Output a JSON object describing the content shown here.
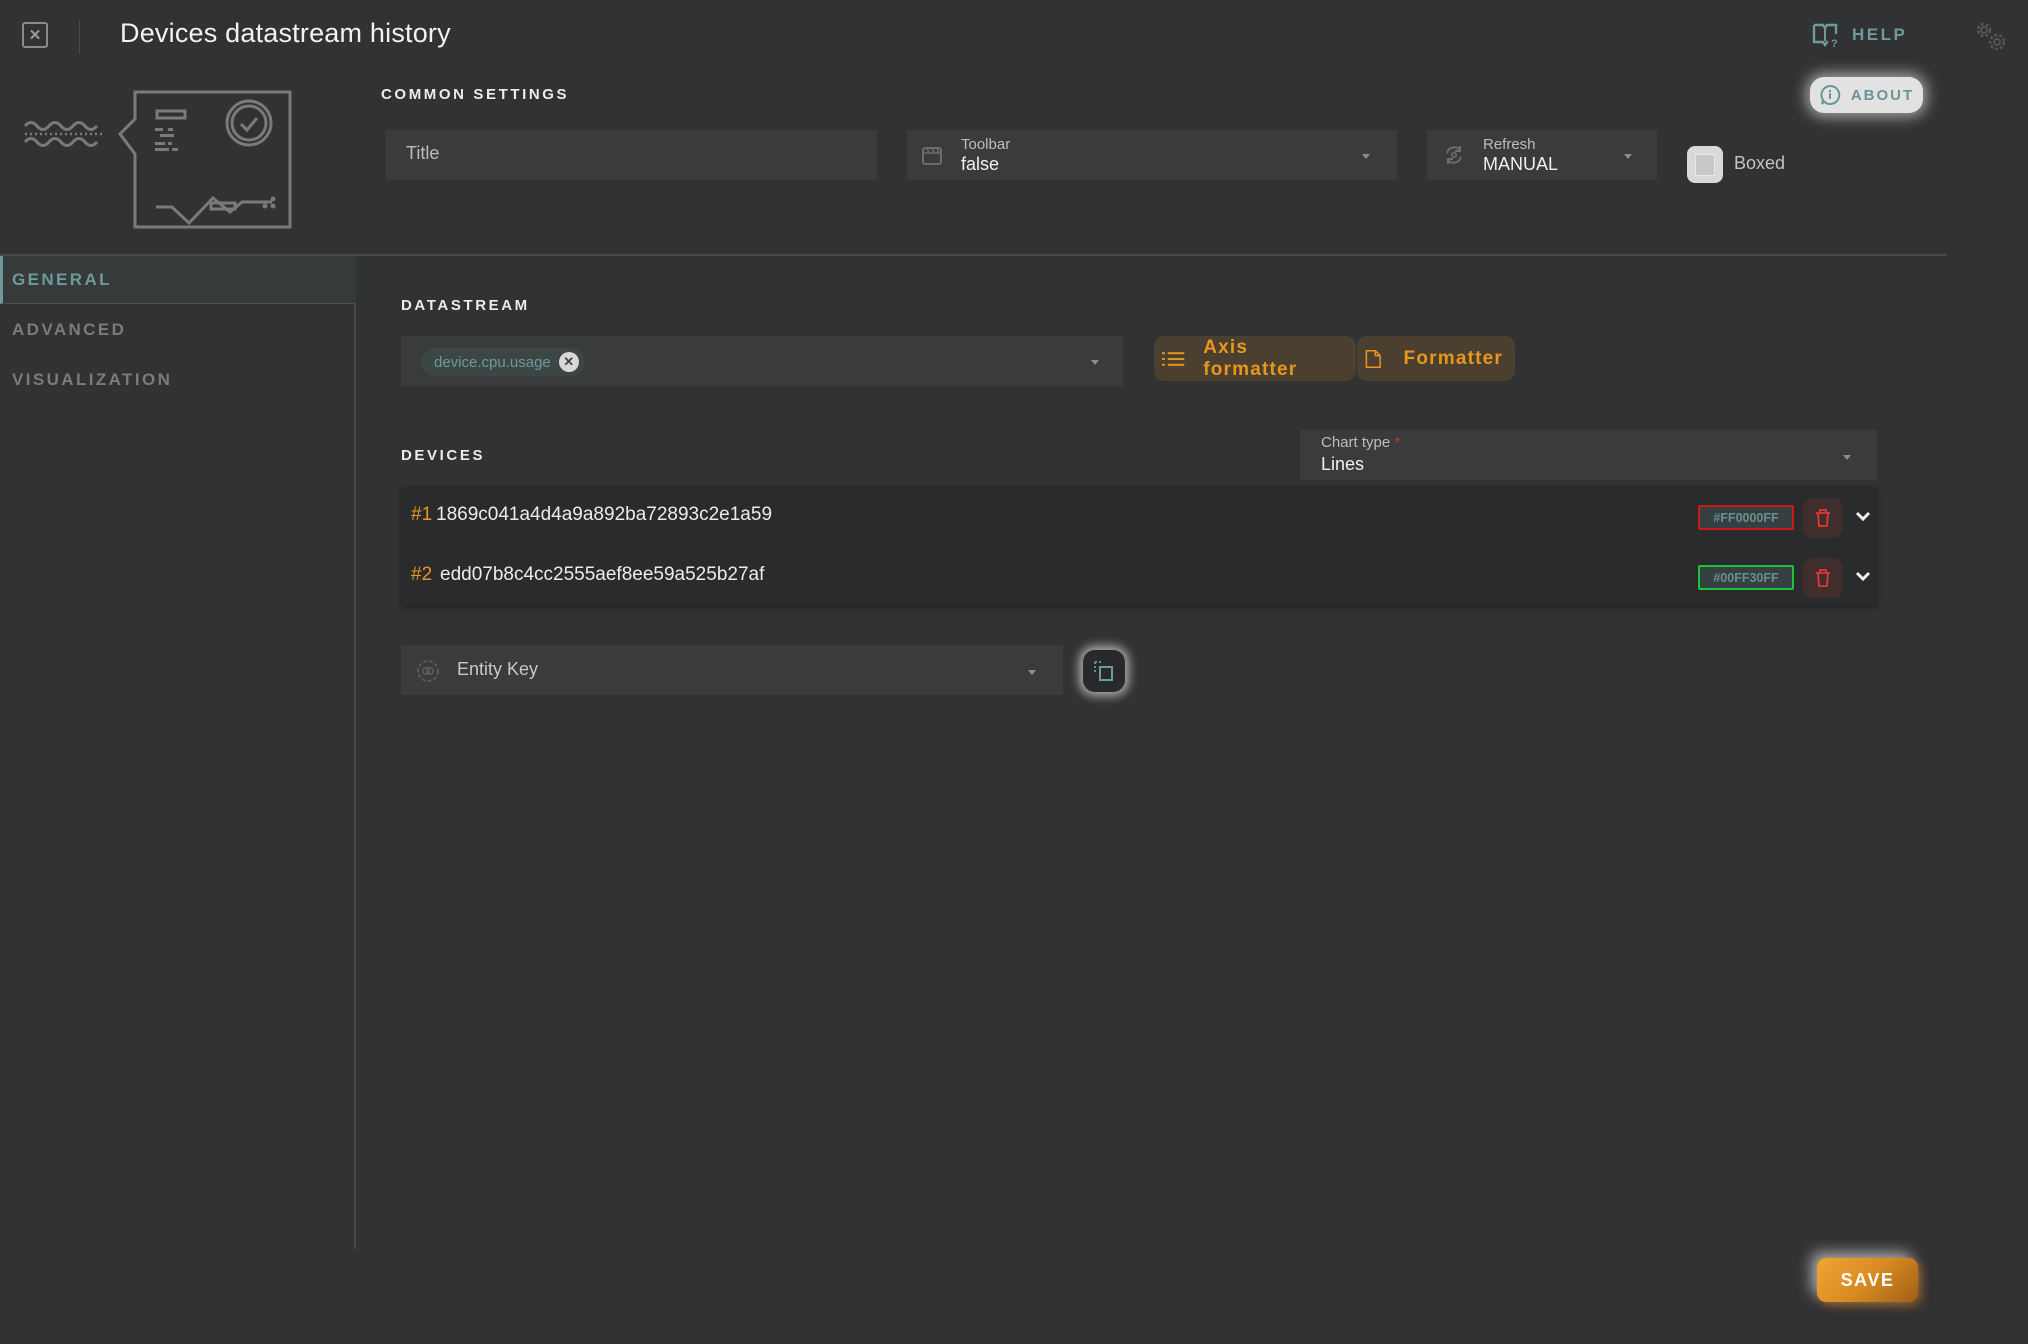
{
  "header": {
    "title": "Devices datastream history",
    "close_icon": "close-x-icon",
    "help_label": "HELP",
    "help_icon": "book-question-icon",
    "settings_icon": "gears-icon"
  },
  "common_settings": {
    "section_label": "COMMON SETTINGS",
    "about_label": "ABOUT",
    "about_icon": "info-bubble-icon",
    "title_field": {
      "placeholder": "Title",
      "value": ""
    },
    "toolbar_field": {
      "label": "Toolbar",
      "value": "false",
      "icon": "clapperboard-icon"
    },
    "refresh_field": {
      "label": "Refresh",
      "value": "MANUAL",
      "icon": "refresh-icon"
    },
    "boxed": {
      "label": "Boxed",
      "checked": false
    }
  },
  "sidebar": {
    "items": [
      {
        "label": "GENERAL",
        "active": true
      },
      {
        "label": "ADVANCED",
        "active": false
      },
      {
        "label": "VISUALIZATION",
        "active": false
      }
    ]
  },
  "datastream": {
    "section_label": "DATASTREAM",
    "chips": [
      {
        "label": "device.cpu.usage"
      }
    ],
    "axis_formatter_label": "Axis formatter",
    "formatter_label": "Formatter"
  },
  "devices": {
    "section_label": "DEVICES",
    "chart_type": {
      "label": "Chart type",
      "required_mark": "*",
      "value": "Lines"
    },
    "items": [
      {
        "index": "#1",
        "id": "1869c041a4d4a9a892ba72893c2e1a59",
        "color": "#FF0000FF",
        "border": "#d01818"
      },
      {
        "index": "#2",
        "id": "edd07b8c4cc2555aef8ee59a525b27af",
        "color": "#00FF30FF",
        "border": "#1fc23a"
      }
    ]
  },
  "entity_key": {
    "placeholder": "Entity Key",
    "icon": "target-icon"
  },
  "footer": {
    "save_label": "SAVE"
  },
  "colors": {
    "accent_teal": "#6e9a9c",
    "accent_orange": "#e8961e",
    "background": "#313234",
    "danger": "#e03a32"
  }
}
